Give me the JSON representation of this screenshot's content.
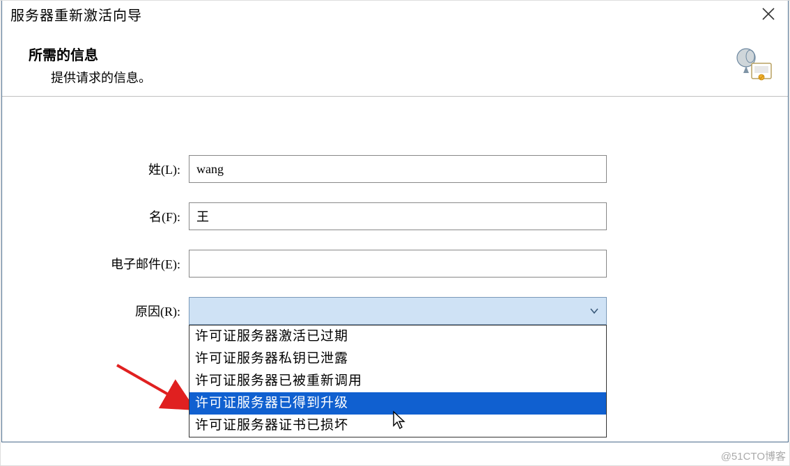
{
  "window": {
    "title": "服务器重新激活向导"
  },
  "header": {
    "title": "所需的信息",
    "subtitle": "提供请求的信息。"
  },
  "form": {
    "last_name_label": "姓(L):",
    "last_name_value": "wang",
    "first_name_label": "名(F):",
    "first_name_value": "王",
    "email_label": "电子邮件(E):",
    "email_value": "",
    "reason_label": "原因(R):",
    "reason_value": ""
  },
  "dropdown": {
    "items": [
      "许可证服务器激活已过期",
      "许可证服务器私钥已泄露",
      "许可证服务器已被重新调用",
      "许可证服务器已得到升级",
      "许可证服务器证书已损坏"
    ],
    "selected_index": 3
  },
  "watermark": "@51CTO博客"
}
